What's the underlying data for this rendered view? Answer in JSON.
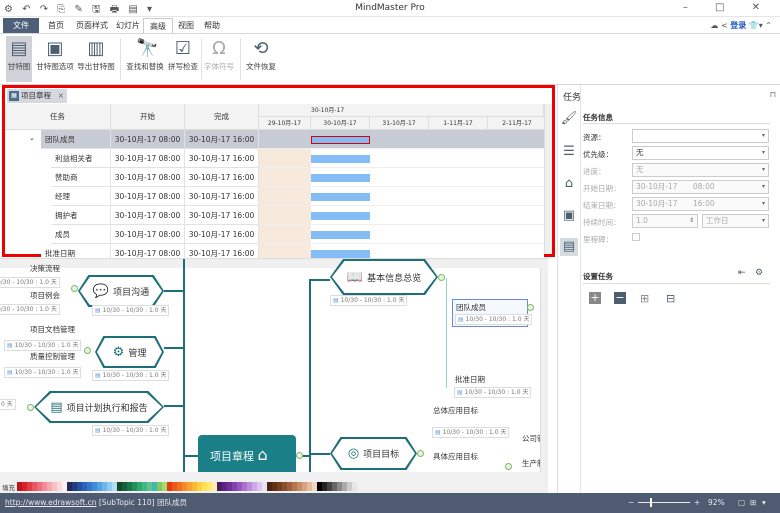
{
  "titlebar": {
    "title": "MindMaster Pro",
    "quick_access": "⚙ ↶ ↷ ⎘ ✎ 🖫 🖶 ▤ ▾",
    "window_controls": "– □ ✕"
  },
  "menu": {
    "tabs": [
      "文件",
      "首页",
      "页面样式",
      "幻灯片",
      "高级",
      "视图",
      "帮助"
    ],
    "active": "高级",
    "login": "登录"
  },
  "ribbon": {
    "buttons": [
      {
        "label": "甘特图",
        "icon": "gantt-icon"
      },
      {
        "label": "甘特图选项",
        "icon": "gantt-options-icon"
      },
      {
        "label": "导出甘特图",
        "icon": "export-gantt-icon"
      },
      {
        "label": "查找和替换",
        "icon": "binoculars-icon"
      },
      {
        "label": "拼写检查",
        "icon": "spellcheck-icon"
      },
      {
        "label": "字体符号",
        "icon": "omega-icon"
      },
      {
        "label": "文件恢复",
        "icon": "history-icon"
      }
    ]
  },
  "gantt": {
    "tab_label": "项目章程",
    "columns": [
      "任务",
      "开始",
      "完成"
    ],
    "timeline_top": "30-10月-17",
    "days": [
      "29-10月-17",
      "30-10月-17",
      "31-10月-17",
      "1-11月-17",
      "2-11月-17"
    ],
    "rows": [
      {
        "task": "团队成员",
        "start": "30-10月-17 08:00",
        "end": "30-10月-17 16:00",
        "level": 0,
        "group": true
      },
      {
        "task": "利益相关者",
        "start": "30-10月-17 08:00",
        "end": "30-10月-17 16:00",
        "level": 1
      },
      {
        "task": "赞助商",
        "start": "30-10月-17 08:00",
        "end": "30-10月-17 16:00",
        "level": 1
      },
      {
        "task": "经理",
        "start": "30-10月-17 08:00",
        "end": "30-10月-17 16:00",
        "level": 1
      },
      {
        "task": "拥护者",
        "start": "30-10月-17 08:00",
        "end": "30-10月-17 16:00",
        "level": 1
      },
      {
        "task": "成员",
        "start": "30-10月-17 08:00",
        "end": "30-10月-17 16:00",
        "level": 1
      },
      {
        "task": "批准日期",
        "start": "30-10月-17 08:00",
        "end": "30-10月-17 16:00",
        "level": 0
      }
    ]
  },
  "task_panel": {
    "title": "任务",
    "section_info": "任务信息",
    "fields": {
      "resource": {
        "label": "资源：",
        "value": ""
      },
      "priority": {
        "label": "优先级：",
        "value": "无"
      },
      "progress": {
        "label": "进度：",
        "value": "无"
      },
      "start_date": {
        "label": "开始日期：",
        "date": "30-10月-17",
        "time": "08:00"
      },
      "end_date": {
        "label": "结束日期：",
        "date": "30-10月-17",
        "time": "16:00"
      },
      "duration": {
        "label": "持续时间：",
        "value": "1.0",
        "unit": "工作日"
      },
      "milestone": {
        "label": "里程碑：",
        "checked": false
      }
    },
    "section_set": "设置任务"
  },
  "mindmap": {
    "central": "项目章程",
    "date_label": "10/30 - 10/30 : 1.0 天",
    "date_label_short": "0 天",
    "topics": {
      "communication": "项目沟通",
      "management": "管理",
      "plan": "项目计划执行和报告",
      "overview": "基本信息总览",
      "goal": "项目目标"
    },
    "subtopics": {
      "decision": "决策流程",
      "meeting": "项目例会",
      "docs": "项目文档管理",
      "quality": "质量控制管理",
      "team": "团队成员",
      "approve": "批准日期",
      "overall_goal": "总体应用目标",
      "specific_goal": "具体应用目标",
      "company": "公司管",
      "production": "生产制"
    }
  },
  "palette": {
    "label": "填充",
    "colors": [
      "#c0141c",
      "#d8202a",
      "#e43a48",
      "#e85566",
      "#ee7080",
      "#f28c98",
      "#f5a8b0",
      "#f7c0c6",
      "#fad8dc",
      "#fdeef0",
      "#1a2a5a",
      "#1f3c7a",
      "#244f9a",
      "#2a64b8",
      "#3378cc",
      "#3c8cd8",
      "#52a2e2",
      "#6cb6ea",
      "#8ccaf0",
      "#b0dcf5",
      "#0f4a2a",
      "#156038",
      "#1c7848",
      "#24905a",
      "#2ea86c",
      "#40b880",
      "#5cc494",
      "#44b8a8",
      "#80c860",
      "#a8d870",
      "#e04010",
      "#ea5a18",
      "#f07020",
      "#f48a28",
      "#f8a030",
      "#fab838",
      "#fcd040",
      "#fee050",
      "#fee878",
      "#fff0a8",
      "#4a1a6a",
      "#5c2480",
      "#702e98",
      "#8440ae",
      "#9856c0",
      "#aa70ce",
      "#bc8cda",
      "#cca8e4",
      "#dcc4ee",
      "#ece0f6",
      "#4a2410",
      "#5e3018",
      "#743e22",
      "#8a4e2e",
      "#a0603c",
      "#b4744e",
      "#c68a66",
      "#d6a282",
      "#e4bca2",
      "#f0d6c4",
      "#000000",
      "#222222",
      "#444444",
      "#666666",
      "#888888",
      "#aaaaaa",
      "#cccccc",
      "#e6e6e6"
    ]
  },
  "status": {
    "link": "http://www.edrawsoft.cn",
    "topic": "[SubTopic 110]",
    "selection": "团队成员",
    "zoom": "92%"
  }
}
